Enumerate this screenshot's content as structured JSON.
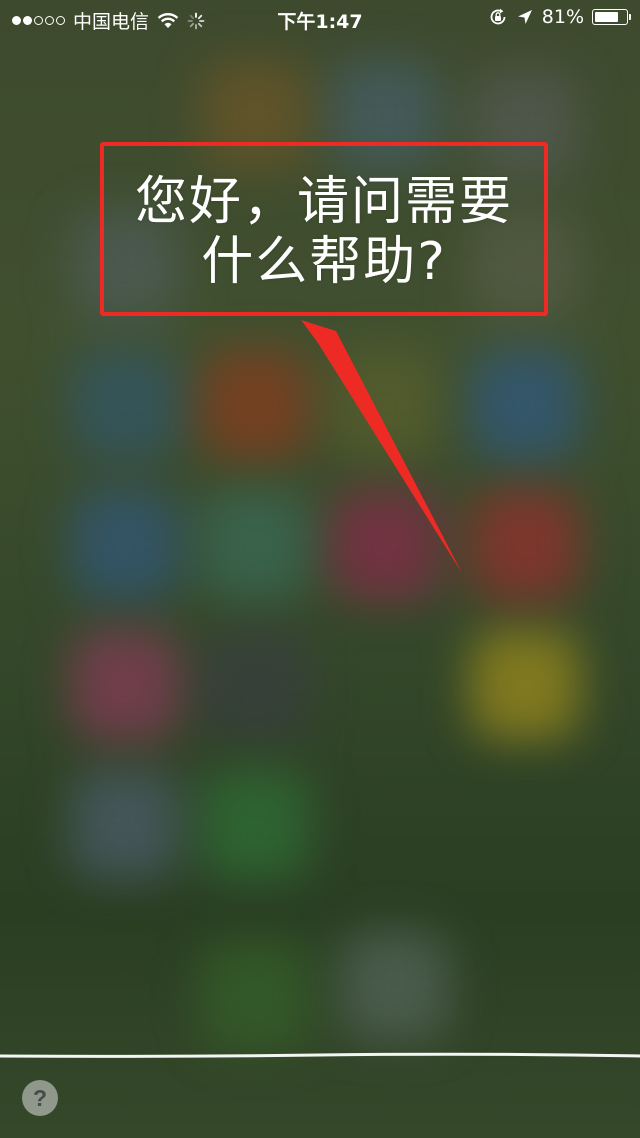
{
  "status_bar": {
    "signal_filled": 2,
    "signal_total": 5,
    "carrier": "中国电信",
    "time": "下午1:47",
    "battery_percent": "81%",
    "battery_level": 0.81,
    "icons": [
      "wifi-icon",
      "activity-spinner-icon",
      "rotation-lock-icon",
      "location-arrow-icon",
      "battery-icon"
    ]
  },
  "siri": {
    "prompt_line1": "您好，请问需要",
    "prompt_line2": "什么帮助?"
  },
  "annotation": {
    "box_color": "#ee2a24",
    "arrow_color": "#ee2a24"
  },
  "help": {
    "label": "?"
  }
}
